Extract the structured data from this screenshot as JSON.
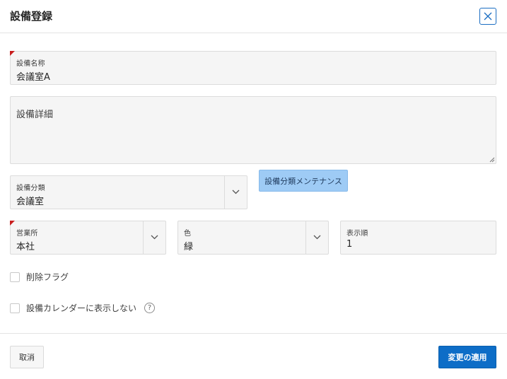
{
  "dialog": {
    "title": "設備登録",
    "close_icon": "close-icon"
  },
  "form": {
    "equipment_name": {
      "label": "設備名称",
      "value": "会議室A",
      "required": true
    },
    "equipment_detail": {
      "placeholder": "設備詳細",
      "value": ""
    },
    "equipment_category": {
      "label": "設備分類",
      "value": "会議室"
    },
    "category_maintenance_button": "設備分類メンテナンス",
    "office": {
      "label": "営業所",
      "value": "本社",
      "required": true
    },
    "color": {
      "label": "色",
      "value": "緑"
    },
    "display_order": {
      "label": "表示順",
      "value": "1"
    },
    "delete_flag": {
      "label": "削除フラグ",
      "checked": false
    },
    "hide_in_calendar": {
      "label": "設備カレンダーに表示しない",
      "checked": false,
      "help_icon": "?"
    }
  },
  "footer": {
    "cancel_label": "取消",
    "apply_label": "変更の適用"
  },
  "colors": {
    "primary": "#0d6dc7",
    "secondary_button": "#9ecbf5",
    "required_marker": "#c81e1e"
  }
}
